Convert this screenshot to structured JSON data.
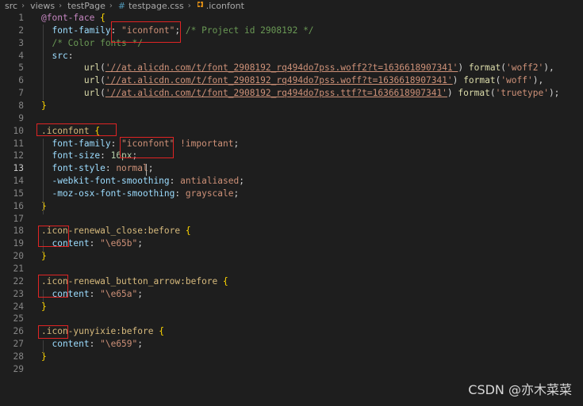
{
  "breadcrumb": {
    "items": [
      "src",
      "views",
      "testPage"
    ],
    "file": "testpage.css",
    "symbol": ".iconfont",
    "file_icon": "hash-icon",
    "symbol_icon": "symbol-class-icon"
  },
  "watermark": "CSDN @亦木菜菜",
  "lines": [
    {
      "n": "1",
      "tokens": [
        {
          "t": "@font-face",
          "c": "at"
        },
        {
          "t": " ",
          "c": "plain"
        },
        {
          "t": "{",
          "c": "brace"
        }
      ]
    },
    {
      "n": "2",
      "tokens": [
        {
          "t": "  font-family",
          "c": "prop"
        },
        {
          "t": ": ",
          "c": "plain"
        },
        {
          "t": "\"iconfont\"",
          "c": "str"
        },
        {
          "t": "; ",
          "c": "plain"
        },
        {
          "t": "/* Project id 2908192 */",
          "c": "cmt"
        }
      ]
    },
    {
      "n": "3",
      "tokens": [
        {
          "t": "  /* Color fonts */",
          "c": "cmt"
        }
      ]
    },
    {
      "n": "4",
      "tokens": [
        {
          "t": "  src",
          "c": "prop"
        },
        {
          "t": ":",
          "c": "plain"
        }
      ]
    },
    {
      "n": "5",
      "tokens": [
        {
          "t": "        url",
          "c": "fn"
        },
        {
          "t": "(",
          "c": "plain"
        },
        {
          "t": "'//at.alicdn.com/t/font_2908192_rq494do7pss.woff2?t=1636618907341'",
          "c": "url"
        },
        {
          "t": ") ",
          "c": "plain"
        },
        {
          "t": "format",
          "c": "fn"
        },
        {
          "t": "(",
          "c": "plain"
        },
        {
          "t": "'woff2'",
          "c": "str"
        },
        {
          "t": "),",
          "c": "plain"
        }
      ]
    },
    {
      "n": "6",
      "tokens": [
        {
          "t": "        url",
          "c": "fn"
        },
        {
          "t": "(",
          "c": "plain"
        },
        {
          "t": "'//at.alicdn.com/t/font_2908192_rq494do7pss.woff?t=1636618907341'",
          "c": "url"
        },
        {
          "t": ") ",
          "c": "plain"
        },
        {
          "t": "format",
          "c": "fn"
        },
        {
          "t": "(",
          "c": "plain"
        },
        {
          "t": "'woff'",
          "c": "str"
        },
        {
          "t": "),",
          "c": "plain"
        }
      ]
    },
    {
      "n": "7",
      "tokens": [
        {
          "t": "        url",
          "c": "fn"
        },
        {
          "t": "(",
          "c": "plain"
        },
        {
          "t": "'//at.alicdn.com/t/font_2908192_rq494do7pss.ttf?t=1636618907341'",
          "c": "url"
        },
        {
          "t": ") ",
          "c": "plain"
        },
        {
          "t": "format",
          "c": "fn"
        },
        {
          "t": "(",
          "c": "plain"
        },
        {
          "t": "'truetype'",
          "c": "str"
        },
        {
          "t": ");",
          "c": "plain"
        }
      ]
    },
    {
      "n": "8",
      "tokens": [
        {
          "t": "}",
          "c": "brace"
        }
      ]
    },
    {
      "n": "9",
      "tokens": []
    },
    {
      "n": "10",
      "tokens": [
        {
          "t": ".iconfont",
          "c": "sel"
        },
        {
          "t": " ",
          "c": "plain"
        },
        {
          "t": "{",
          "c": "brace"
        }
      ]
    },
    {
      "n": "11",
      "tokens": [
        {
          "t": "  font-family",
          "c": "prop"
        },
        {
          "t": ": ",
          "c": "plain"
        },
        {
          "t": "\"iconfont\"",
          "c": "str"
        },
        {
          "t": " ",
          "c": "plain"
        },
        {
          "t": "!important",
          "c": "str"
        },
        {
          "t": ";",
          "c": "plain"
        }
      ]
    },
    {
      "n": "12",
      "tokens": [
        {
          "t": "  font-size",
          "c": "prop"
        },
        {
          "t": ": ",
          "c": "plain"
        },
        {
          "t": "16px",
          "c": "num"
        },
        {
          "t": ";",
          "c": "plain"
        }
      ]
    },
    {
      "n": "13",
      "active": true,
      "tokens": [
        {
          "t": "  font-style",
          "c": "prop"
        },
        {
          "t": ": ",
          "c": "plain"
        },
        {
          "t": "normal",
          "c": "str"
        },
        {
          "t": ";",
          "c": "plain"
        }
      ]
    },
    {
      "n": "14",
      "tokens": [
        {
          "t": "  -webkit-font-smoothing",
          "c": "prop"
        },
        {
          "t": ": ",
          "c": "plain"
        },
        {
          "t": "antialiased",
          "c": "str"
        },
        {
          "t": ";",
          "c": "plain"
        }
      ]
    },
    {
      "n": "15",
      "tokens": [
        {
          "t": "  -moz-osx-font-smoothing",
          "c": "prop"
        },
        {
          "t": ": ",
          "c": "plain"
        },
        {
          "t": "grayscale",
          "c": "str"
        },
        {
          "t": ";",
          "c": "plain"
        }
      ]
    },
    {
      "n": "16",
      "tokens": [
        {
          "t": "}",
          "c": "brace"
        }
      ]
    },
    {
      "n": "17",
      "tokens": []
    },
    {
      "n": "18",
      "tokens": [
        {
          "t": ".icon-renewal_close:before",
          "c": "sel"
        },
        {
          "t": " ",
          "c": "plain"
        },
        {
          "t": "{",
          "c": "brace"
        }
      ]
    },
    {
      "n": "19",
      "tokens": [
        {
          "t": "  content",
          "c": "prop"
        },
        {
          "t": ": ",
          "c": "plain"
        },
        {
          "t": "\"\\e65b\"",
          "c": "str"
        },
        {
          "t": ";",
          "c": "plain"
        }
      ]
    },
    {
      "n": "20",
      "tokens": [
        {
          "t": "}",
          "c": "brace"
        }
      ]
    },
    {
      "n": "21",
      "tokens": []
    },
    {
      "n": "22",
      "tokens": [
        {
          "t": ".icon-renewal_button_arrow:before",
          "c": "sel"
        },
        {
          "t": " ",
          "c": "plain"
        },
        {
          "t": "{",
          "c": "brace"
        }
      ]
    },
    {
      "n": "23",
      "tokens": [
        {
          "t": "  content",
          "c": "prop"
        },
        {
          "t": ": ",
          "c": "plain"
        },
        {
          "t": "\"\\e65a\"",
          "c": "str"
        },
        {
          "t": ";",
          "c": "plain"
        }
      ]
    },
    {
      "n": "24",
      "tokens": [
        {
          "t": "}",
          "c": "brace"
        }
      ]
    },
    {
      "n": "25",
      "tokens": []
    },
    {
      "n": "26",
      "tokens": [
        {
          "t": ".icon-yunyixie:before",
          "c": "sel"
        },
        {
          "t": " ",
          "c": "plain"
        },
        {
          "t": "{",
          "c": "brace"
        }
      ]
    },
    {
      "n": "27",
      "tokens": [
        {
          "t": "  content",
          "c": "prop"
        },
        {
          "t": ": ",
          "c": "plain"
        },
        {
          "t": "\"\\e659\"",
          "c": "str"
        },
        {
          "t": ";",
          "c": "plain"
        }
      ]
    },
    {
      "n": "28",
      "tokens": [
        {
          "t": "}",
          "c": "brace"
        }
      ]
    },
    {
      "n": "29",
      "tokens": []
    }
  ],
  "colors": {
    "background": "#1e1e1e",
    "annotation_box": "#e02424",
    "selector": "#d7ba7d",
    "property": "#9cdcfe",
    "string": "#ce9178",
    "comment": "#6a9955",
    "at_rule": "#c586c0",
    "function": "#dcdcaa",
    "number": "#b5cea8",
    "brace": "#ffd700"
  }
}
